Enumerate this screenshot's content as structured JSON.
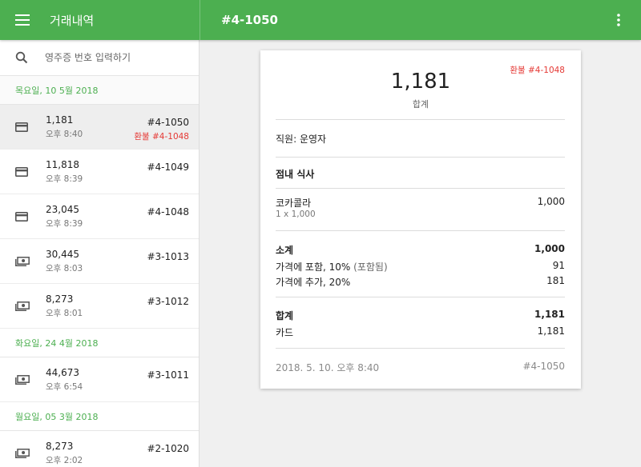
{
  "appbar": {
    "title": "거래내역",
    "detail_title": "#4-1050",
    "menu_icon": "menu-icon",
    "more_icon": "more-vert-icon",
    "color": "#4caf50"
  },
  "search": {
    "placeholder": "영주증 번호 입력하기",
    "icon": "search-icon"
  },
  "groups": [
    {
      "date": "목요일, 10 5월 2018",
      "items": [
        {
          "amount": "1,181",
          "time": "오후 8:40",
          "number": "#4-1050",
          "refund": "환불 #4-1048",
          "icon": "card-icon",
          "selected": true
        },
        {
          "amount": "11,818",
          "time": "오후 8:39",
          "number": "#4-1049",
          "icon": "card-icon"
        },
        {
          "amount": "23,045",
          "time": "오후 8:39",
          "number": "#4-1048",
          "icon": "card-icon"
        },
        {
          "amount": "30,445",
          "time": "오후 8:03",
          "number": "#3-1013",
          "icon": "cash-icon"
        },
        {
          "amount": "8,273",
          "time": "오후 8:01",
          "number": "#3-1012",
          "icon": "cash-icon"
        }
      ]
    },
    {
      "date": "화요일, 24 4월 2018",
      "items": [
        {
          "amount": "44,673",
          "time": "오후 6:54",
          "number": "#3-1011",
          "icon": "cash-icon"
        }
      ]
    },
    {
      "date": "월요일, 05 3월 2018",
      "items": [
        {
          "amount": "8,273",
          "time": "오후 2:02",
          "number": "#2-1020",
          "icon": "cash-icon"
        }
      ]
    }
  ],
  "receipt": {
    "refund_note": "환불 #4-1048",
    "total": "1,181",
    "total_caption": "합계",
    "employee": "직원: 운영자",
    "dining": "점내 식사",
    "item": {
      "name": "코카콜라",
      "detail": "1 x 1,000",
      "price": "1,000"
    },
    "subtotal": {
      "label": "소계",
      "value": "1,000"
    },
    "tax_included": {
      "label": "가격에 포함, 10%",
      "note": "(포함됨)",
      "value": "91"
    },
    "tax_added": {
      "label": "가격에 추가, 20%",
      "value": "181"
    },
    "grand_total": {
      "label": "합계",
      "value": "1,181"
    },
    "payment": {
      "label": "카드",
      "value": "1,181"
    },
    "footer_date": "2018. 5. 10. 오후 8:40",
    "footer_number": "#4-1050"
  }
}
